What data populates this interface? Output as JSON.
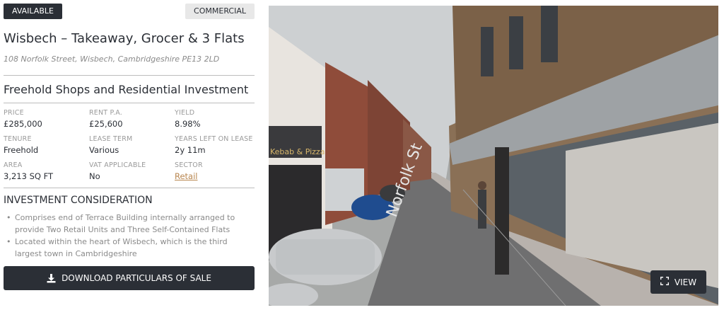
{
  "listing": {
    "status_badge": "AVAILABLE",
    "category_badge": "COMMERCIAL",
    "title": "Wisbech – Takeaway, Grocer & 3 Flats",
    "address": "108 Norfolk Street, Wisbech, Cambridgeshire PE13 2LD",
    "subtitle": "Freehold Shops and Residential Investment"
  },
  "details": [
    {
      "label": "PRICE",
      "value": "£285,000"
    },
    {
      "label": "RENT P.A.",
      "value": "£25,600"
    },
    {
      "label": "YIELD",
      "value": "8.98%"
    },
    {
      "label": "TENURE",
      "value": "Freehold"
    },
    {
      "label": "LEASE TERM",
      "value": "Various"
    },
    {
      "label": "YEARS LEFT ON LEASE",
      "value": "2y 11m"
    },
    {
      "label": "AREA",
      "value": "3,213 SQ FT"
    },
    {
      "label": "VAT APPLICABLE",
      "value": "No"
    },
    {
      "label": "SECTOR",
      "value": "Retail"
    }
  ],
  "investment": {
    "heading": "INVESTMENT CONSIDERATION",
    "points": [
      "Comprises end of Terrace Building internally arranged to provide Two Retail Units and Three Self-Contained Flats",
      "Located within the heart of Wisbech, which is the third largest town in Cambridgeshire"
    ]
  },
  "actions": {
    "download_label": "DOWNLOAD PARTICULARS OF SALE",
    "download_icon": "download-icon",
    "view_label": "VIEW",
    "view_icon": "expand-icon"
  },
  "photo": {
    "street_sign_text": "Norfolk St",
    "shop_sign_text": "Kebab & Pizza"
  },
  "colors": {
    "dark": "#2b2f36",
    "badge_light": "#e8e8e8",
    "link": "#b8864f",
    "muted": "#8a8a8a"
  }
}
